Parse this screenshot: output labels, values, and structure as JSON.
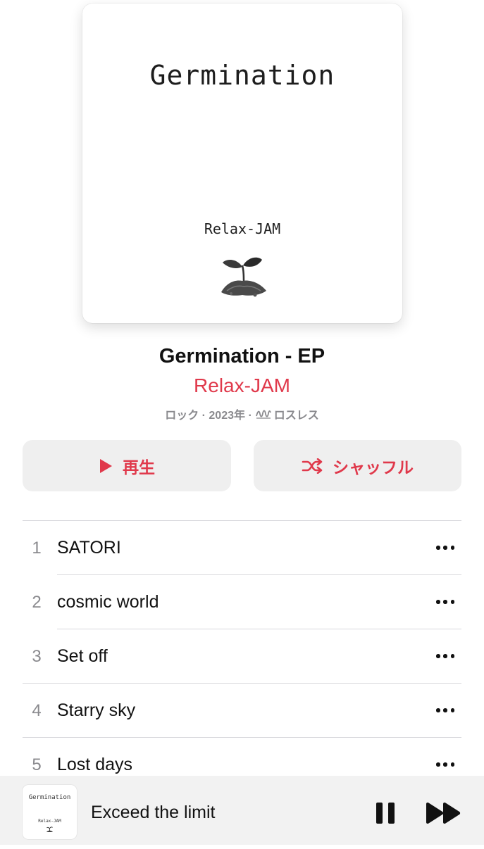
{
  "album": {
    "cover_title": "Germination",
    "cover_artist": "Relax-JAM",
    "title": "Germination - EP",
    "artist": "Relax-JAM",
    "meta_prefix": "ロック · 2023年 ·",
    "meta_suffix": "ロスレス",
    "icons": {
      "lossless": "lossless-waveform-icon",
      "sprout": "sprout-icon"
    }
  },
  "actions": {
    "play_label": "再生",
    "shuffle_label": "シャッフル",
    "icons": {
      "play": "play-icon",
      "shuffle": "shuffle-icon"
    }
  },
  "tracks": [
    {
      "number": "1",
      "title": "SATORI"
    },
    {
      "number": "2",
      "title": "cosmic world"
    },
    {
      "number": "3",
      "title": "Set off"
    },
    {
      "number": "4",
      "title": "Starry sky"
    },
    {
      "number": "5",
      "title": "Lost days"
    }
  ],
  "now_playing": {
    "cover_title": "Germination",
    "cover_artist": "Relax-JAM",
    "title": "Exceed the limit",
    "icons": {
      "pause": "pause-icon",
      "next": "fast-forward-icon"
    }
  },
  "colors": {
    "accent": "#e0394b",
    "secondary_text": "#8a8a8e",
    "button_bg": "#efefef",
    "mini_player_bg": "#f2f2f2"
  }
}
